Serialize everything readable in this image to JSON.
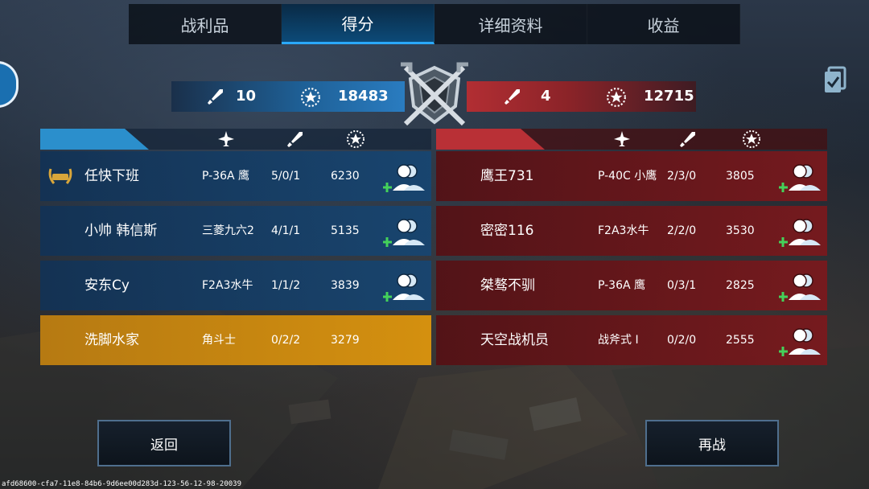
{
  "tabs": [
    {
      "label": "战利品",
      "active": false
    },
    {
      "label": "得分",
      "active": true
    },
    {
      "label": "详细资料",
      "active": false
    },
    {
      "label": "收益",
      "active": false
    }
  ],
  "scoreboard": {
    "blue": {
      "kills": "10",
      "score": "18483"
    },
    "red": {
      "kills": "4",
      "score": "12715"
    }
  },
  "blue_team": [
    {
      "name": "任快下班",
      "plane": "P-36A 鹰",
      "kda": "5/0/1",
      "score": "6230",
      "badge": "MVP wreath",
      "highlight": false,
      "add_friend": true
    },
    {
      "name": "小帅 韩信斯",
      "plane": "三菱九六2",
      "kda": "4/1/1",
      "score": "5135",
      "badge": "",
      "highlight": false,
      "add_friend": true
    },
    {
      "name": "安东Cy",
      "plane": "F2A3水牛",
      "kda": "1/1/2",
      "score": "3839",
      "badge": "",
      "highlight": false,
      "add_friend": true
    },
    {
      "name": "洗脚水家",
      "plane": "角斗士",
      "kda": "0/2/2",
      "score": "3279",
      "badge": "",
      "highlight": true,
      "add_friend": false
    }
  ],
  "red_team": [
    {
      "name": "鹰王731",
      "plane": "P-40C 小鹰",
      "kda": "2/3/0",
      "score": "3805",
      "add_friend": true
    },
    {
      "name": "密密116",
      "plane": "F2A3水牛",
      "kda": "2/2/0",
      "score": "3530",
      "add_friend": true
    },
    {
      "name": "桀骜不驯",
      "plane": "P-36A 鹰",
      "kda": "0/3/1",
      "score": "2825",
      "add_friend": true
    },
    {
      "name": "天空战机员",
      "plane": "战斧式 I",
      "kda": "0/2/0",
      "score": "2555",
      "add_friend": true
    }
  ],
  "buttons": {
    "back": "返回",
    "rematch": "再战"
  },
  "footer_id": "afd68600-cfa7-11e8-84b6-9d6ee00d283d-123-56-12-98-20039",
  "colors": {
    "blue_accent": "#2b8fcc",
    "red_accent": "#b93036",
    "gold_highlight": "#d4900f",
    "tab_active": "#0c4a78"
  },
  "icons": {
    "header_columns": [
      "plane-icon",
      "sword-icon",
      "star-medal-icon"
    ],
    "scoreboard": [
      "sword-icon",
      "star-medal-icon",
      "crossed-swords-emblem-icon"
    ],
    "row_action": "add-friend-icon",
    "corner": "clipboard-check-icon"
  }
}
